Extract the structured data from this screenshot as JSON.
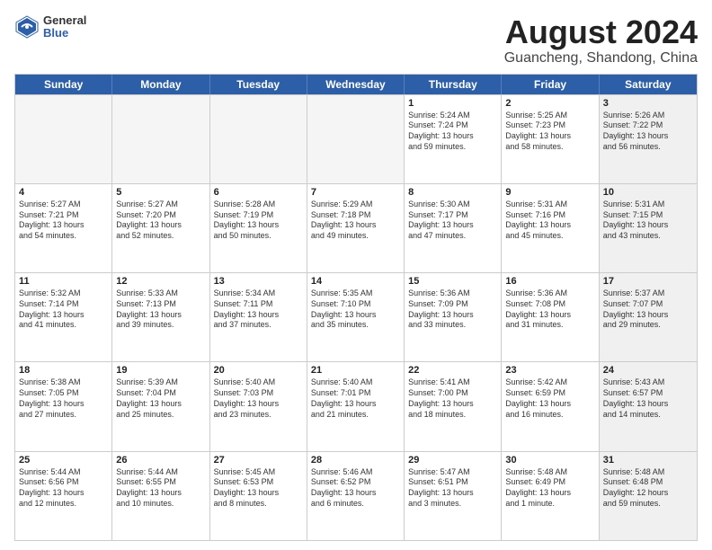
{
  "logo": {
    "general": "General",
    "blue": "Blue"
  },
  "title": "August 2024",
  "subtitle": "Guancheng, Shandong, China",
  "days": [
    "Sunday",
    "Monday",
    "Tuesday",
    "Wednesday",
    "Thursday",
    "Friday",
    "Saturday"
  ],
  "rows": [
    [
      {
        "num": "",
        "lines": [],
        "empty": true
      },
      {
        "num": "",
        "lines": [],
        "empty": true
      },
      {
        "num": "",
        "lines": [],
        "empty": true
      },
      {
        "num": "",
        "lines": [],
        "empty": true
      },
      {
        "num": "1",
        "lines": [
          "Sunrise: 5:24 AM",
          "Sunset: 7:24 PM",
          "Daylight: 13 hours",
          "and 59 minutes."
        ]
      },
      {
        "num": "2",
        "lines": [
          "Sunrise: 5:25 AM",
          "Sunset: 7:23 PM",
          "Daylight: 13 hours",
          "and 58 minutes."
        ]
      },
      {
        "num": "3",
        "lines": [
          "Sunrise: 5:26 AM",
          "Sunset: 7:22 PM",
          "Daylight: 13 hours",
          "and 56 minutes."
        ],
        "shaded": true
      }
    ],
    [
      {
        "num": "4",
        "lines": [
          "Sunrise: 5:27 AM",
          "Sunset: 7:21 PM",
          "Daylight: 13 hours",
          "and 54 minutes."
        ]
      },
      {
        "num": "5",
        "lines": [
          "Sunrise: 5:27 AM",
          "Sunset: 7:20 PM",
          "Daylight: 13 hours",
          "and 52 minutes."
        ]
      },
      {
        "num": "6",
        "lines": [
          "Sunrise: 5:28 AM",
          "Sunset: 7:19 PM",
          "Daylight: 13 hours",
          "and 50 minutes."
        ]
      },
      {
        "num": "7",
        "lines": [
          "Sunrise: 5:29 AM",
          "Sunset: 7:18 PM",
          "Daylight: 13 hours",
          "and 49 minutes."
        ]
      },
      {
        "num": "8",
        "lines": [
          "Sunrise: 5:30 AM",
          "Sunset: 7:17 PM",
          "Daylight: 13 hours",
          "and 47 minutes."
        ]
      },
      {
        "num": "9",
        "lines": [
          "Sunrise: 5:31 AM",
          "Sunset: 7:16 PM",
          "Daylight: 13 hours",
          "and 45 minutes."
        ]
      },
      {
        "num": "10",
        "lines": [
          "Sunrise: 5:31 AM",
          "Sunset: 7:15 PM",
          "Daylight: 13 hours",
          "and 43 minutes."
        ],
        "shaded": true
      }
    ],
    [
      {
        "num": "11",
        "lines": [
          "Sunrise: 5:32 AM",
          "Sunset: 7:14 PM",
          "Daylight: 13 hours",
          "and 41 minutes."
        ]
      },
      {
        "num": "12",
        "lines": [
          "Sunrise: 5:33 AM",
          "Sunset: 7:13 PM",
          "Daylight: 13 hours",
          "and 39 minutes."
        ]
      },
      {
        "num": "13",
        "lines": [
          "Sunrise: 5:34 AM",
          "Sunset: 7:11 PM",
          "Daylight: 13 hours",
          "and 37 minutes."
        ]
      },
      {
        "num": "14",
        "lines": [
          "Sunrise: 5:35 AM",
          "Sunset: 7:10 PM",
          "Daylight: 13 hours",
          "and 35 minutes."
        ]
      },
      {
        "num": "15",
        "lines": [
          "Sunrise: 5:36 AM",
          "Sunset: 7:09 PM",
          "Daylight: 13 hours",
          "and 33 minutes."
        ]
      },
      {
        "num": "16",
        "lines": [
          "Sunrise: 5:36 AM",
          "Sunset: 7:08 PM",
          "Daylight: 13 hours",
          "and 31 minutes."
        ]
      },
      {
        "num": "17",
        "lines": [
          "Sunrise: 5:37 AM",
          "Sunset: 7:07 PM",
          "Daylight: 13 hours",
          "and 29 minutes."
        ],
        "shaded": true
      }
    ],
    [
      {
        "num": "18",
        "lines": [
          "Sunrise: 5:38 AM",
          "Sunset: 7:05 PM",
          "Daylight: 13 hours",
          "and 27 minutes."
        ]
      },
      {
        "num": "19",
        "lines": [
          "Sunrise: 5:39 AM",
          "Sunset: 7:04 PM",
          "Daylight: 13 hours",
          "and 25 minutes."
        ]
      },
      {
        "num": "20",
        "lines": [
          "Sunrise: 5:40 AM",
          "Sunset: 7:03 PM",
          "Daylight: 13 hours",
          "and 23 minutes."
        ]
      },
      {
        "num": "21",
        "lines": [
          "Sunrise: 5:40 AM",
          "Sunset: 7:01 PM",
          "Daylight: 13 hours",
          "and 21 minutes."
        ]
      },
      {
        "num": "22",
        "lines": [
          "Sunrise: 5:41 AM",
          "Sunset: 7:00 PM",
          "Daylight: 13 hours",
          "and 18 minutes."
        ]
      },
      {
        "num": "23",
        "lines": [
          "Sunrise: 5:42 AM",
          "Sunset: 6:59 PM",
          "Daylight: 13 hours",
          "and 16 minutes."
        ]
      },
      {
        "num": "24",
        "lines": [
          "Sunrise: 5:43 AM",
          "Sunset: 6:57 PM",
          "Daylight: 13 hours",
          "and 14 minutes."
        ],
        "shaded": true
      }
    ],
    [
      {
        "num": "25",
        "lines": [
          "Sunrise: 5:44 AM",
          "Sunset: 6:56 PM",
          "Daylight: 13 hours",
          "and 12 minutes."
        ]
      },
      {
        "num": "26",
        "lines": [
          "Sunrise: 5:44 AM",
          "Sunset: 6:55 PM",
          "Daylight: 13 hours",
          "and 10 minutes."
        ]
      },
      {
        "num": "27",
        "lines": [
          "Sunrise: 5:45 AM",
          "Sunset: 6:53 PM",
          "Daylight: 13 hours",
          "and 8 minutes."
        ]
      },
      {
        "num": "28",
        "lines": [
          "Sunrise: 5:46 AM",
          "Sunset: 6:52 PM",
          "Daylight: 13 hours",
          "and 6 minutes."
        ]
      },
      {
        "num": "29",
        "lines": [
          "Sunrise: 5:47 AM",
          "Sunset: 6:51 PM",
          "Daylight: 13 hours",
          "and 3 minutes."
        ]
      },
      {
        "num": "30",
        "lines": [
          "Sunrise: 5:48 AM",
          "Sunset: 6:49 PM",
          "Daylight: 13 hours",
          "and 1 minute."
        ]
      },
      {
        "num": "31",
        "lines": [
          "Sunrise: 5:48 AM",
          "Sunset: 6:48 PM",
          "Daylight: 12 hours",
          "and 59 minutes."
        ],
        "shaded": true
      }
    ]
  ]
}
